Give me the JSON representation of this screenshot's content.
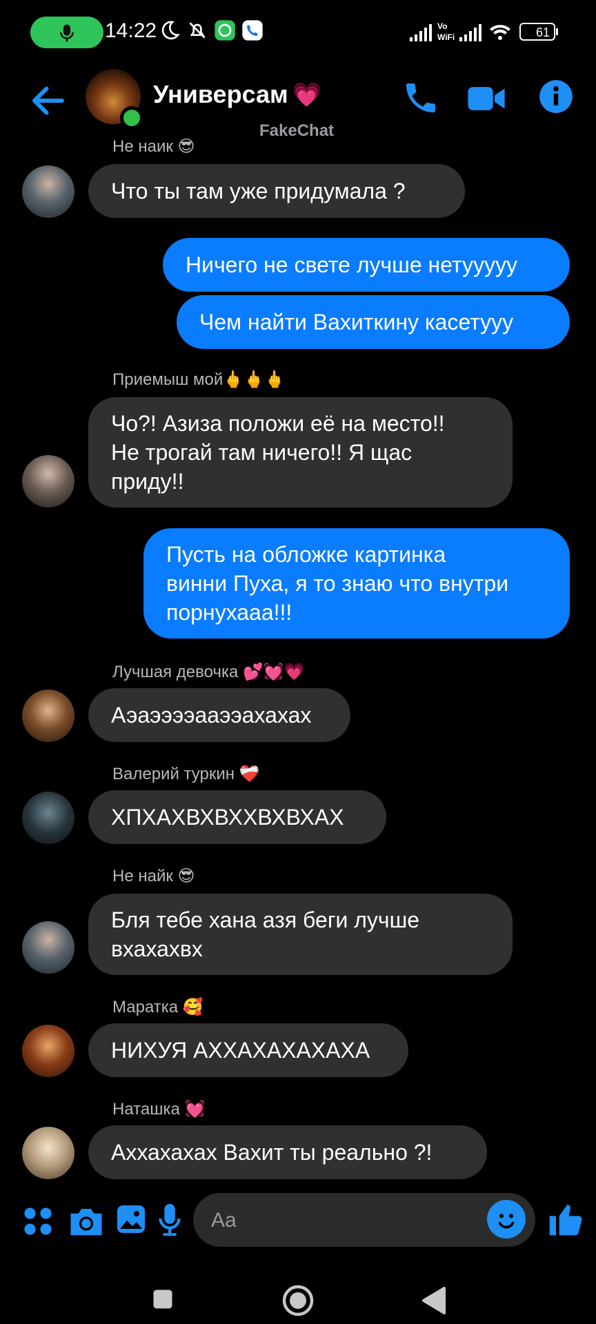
{
  "status_bar": {
    "time": "14:22",
    "battery": "61",
    "network": "Vo WiFi"
  },
  "header": {
    "title": "Универсам",
    "title_emoji": "💗",
    "watermark": "FakeChat",
    "icons": [
      "back-arrow-icon",
      "phone-icon",
      "video-camera-icon",
      "info-icon"
    ]
  },
  "messages": [
    {
      "sender": "Не наик 😎",
      "text": "Что ты там уже придумала ?"
    },
    {
      "text": "Ничего не свете лучше нетууууу"
    },
    {
      "text": "Чем найти Вахиткину касетууу"
    },
    {
      "sender": "Приемыш мой🖕🖕🖕",
      "text": "Чо?! Азиза положи её на место!!\nНе трогай там ничего!! Я щас\nприду!!"
    },
    {
      "text": "Пусть на обложке картинка\nвинни Пуха, я то знаю что внутри\nпорнухааа!!!"
    },
    {
      "sender": "Лучшая девочка 💕💓💗",
      "text": "Аэаээээааээахахах"
    },
    {
      "sender": "Валерий туркин ❤️‍🩹",
      "text": "ХПХАХВХВХХВХВХАХ"
    },
    {
      "sender": "Не найк 😎",
      "text": "Бля тебе хана азя беги лучше\nвхахахвх"
    },
    {
      "sender": "Маратка 🥰",
      "text": "НИХУЯ АХХАХАХАХАХА"
    },
    {
      "sender": "Наташка 💓",
      "text": "Аххахахах Вахит ты реально ?!"
    }
  ],
  "composer": {
    "placeholder": "Aa"
  },
  "colors": {
    "accent": "#0a7cff",
    "incoming_bubble": "#303030",
    "background": "#000000",
    "online": "#31c04a"
  }
}
